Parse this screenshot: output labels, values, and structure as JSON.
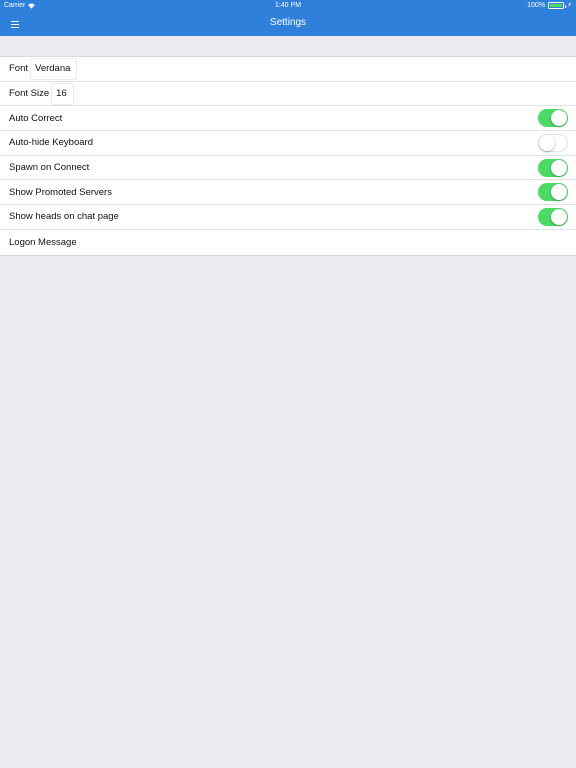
{
  "status_bar": {
    "carrier": "Carrier",
    "time": "1:40 PM",
    "battery": "100%",
    "battery_level": 1.0,
    "wifi_icon": "wifi-icon",
    "charging_icon": "charging-icon"
  },
  "nav": {
    "title": "Settings",
    "menu_icon": "hamburger-menu-icon",
    "bar_color": "#2f80db"
  },
  "settings": {
    "font": {
      "label": "Font",
      "value": "Verdana"
    },
    "font_size": {
      "label": "Font Size",
      "value": "16"
    },
    "auto_correct": {
      "label": "Auto Correct",
      "on": true
    },
    "auto_hide_keyboard": {
      "label": "Auto-hide Keyboard",
      "on": false
    },
    "spawn_on_connect": {
      "label": "Spawn on Connect",
      "on": true
    },
    "show_promoted_servers": {
      "label": "Show Promoted Servers",
      "on": true
    },
    "show_heads_on_chat": {
      "label": "Show heads on chat page",
      "on": true
    },
    "logon_message": {
      "label": "Logon Message"
    }
  },
  "colors": {
    "toggle_on": "#4cd964",
    "background": "#ebeaf0"
  }
}
